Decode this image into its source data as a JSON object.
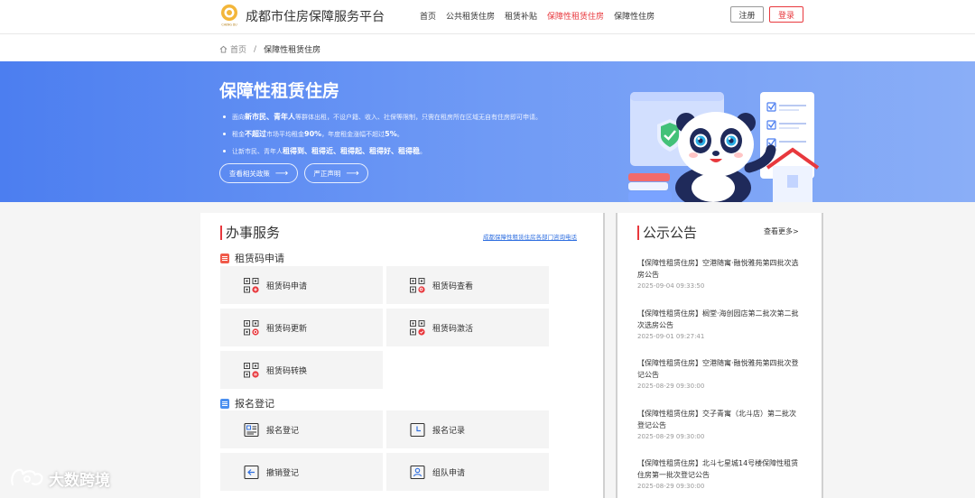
{
  "header": {
    "site_title": "成都市住房保障服务平台",
    "logo_text": "CHENG DU",
    "nav": [
      "首页",
      "公共租赁住房",
      "租赁补贴",
      "保障性租赁住房",
      "保障性住房"
    ],
    "active_nav_index": 3,
    "register_label": "注册",
    "login_label": "登录"
  },
  "breadcrumb": {
    "home": "首页",
    "separator": "/",
    "current": "保障性租赁住房"
  },
  "banner": {
    "title": "保障性租赁住房",
    "bullets": [
      {
        "pre": "面向",
        "hl1": "新市民、青年人",
        "post": "等群体出租，不设户籍、收入、社保等限制，只需在租房所在区域无自有住房即可申请。"
      },
      {
        "pre": "租金",
        "hl1": "不超过",
        "mid": "市场平均租金",
        "hl2": "90%",
        "post": "，年度租金涨幅不超过",
        "hl3": "5%",
        "end": "。"
      },
      {
        "pre": "让新市民、青年人",
        "hl1": "租得到、租得近、租得起、租得好、租得稳",
        "post": "。"
      }
    ],
    "btn_policy": "查看相关政策",
    "btn_statement": "严正声明"
  },
  "services": {
    "title": "办事服务",
    "consult_link": "成都保障性租赁住房各部门咨询电话",
    "sections": [
      {
        "name": "租赁码申请",
        "items": [
          "租赁码申请",
          "租赁码查看",
          "租赁码更新",
          "租赁码激活",
          "租赁码转换"
        ]
      },
      {
        "name": "报名登记",
        "items": [
          "报名登记",
          "报名记录",
          "撤销登记",
          "组队申请"
        ]
      }
    ]
  },
  "notices": {
    "title": "公示公告",
    "more": "查看更多>",
    "items": [
      {
        "title": "【保障性租赁住房】空港随寓·融悦雅苑第四批次选房公告",
        "date": "2025-09-04 09:33:50"
      },
      {
        "title": "【保障性租赁住房】榈堂·海创园店第二批次第二批次选房公告",
        "date": "2025-09-01 09:27:41"
      },
      {
        "title": "【保障性租赁住房】空港随寓·融悦雅苑第四批次登记公告",
        "date": "2025-08-29 09:30:00"
      },
      {
        "title": "【保障性租赁住房】交子青寓（北斗店）第二批次登记公告",
        "date": "2025-08-29 09:30:00"
      },
      {
        "title": "【保障性租赁住房】北斗七星城14号楼保障性租赁住房第一批次登记公告",
        "date": "2025-08-29 09:30:00"
      }
    ]
  },
  "watermark": "大数跨境",
  "colors": {
    "accent_red": "#e8383d",
    "banner_blue": "#4c7ef0",
    "link_blue": "#2f6fe0"
  }
}
